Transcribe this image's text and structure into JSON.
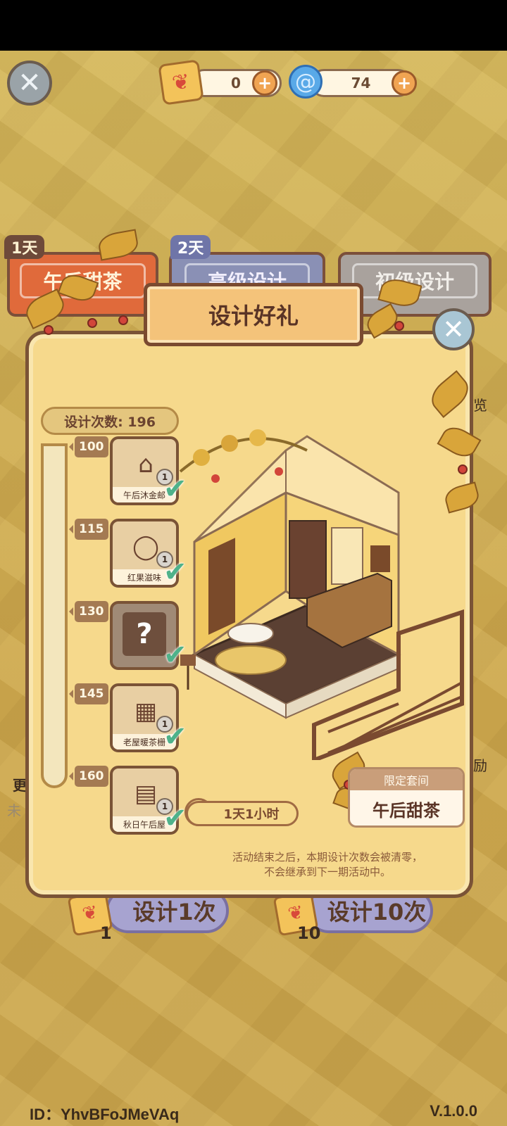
{
  "header": {
    "currency_tickets": "0",
    "currency_swirl": "74",
    "close_icon": "close-icon",
    "plus_icon": "plus-icon"
  },
  "tabs": [
    {
      "day": "1天",
      "label": "午后甜茶"
    },
    {
      "day": "2天",
      "label": "高级设计"
    },
    {
      "day": "",
      "label": "初级设计"
    }
  ],
  "side": {
    "right_top": "览",
    "right_mid": "励",
    "left_a": "更",
    "left_b": "未"
  },
  "modal": {
    "title": "设计好礼",
    "counter": "设计次数: 196",
    "milestones": [
      "100",
      "115",
      "130",
      "145",
      "160"
    ],
    "rewards": [
      {
        "name": "午后沐金邮",
        "qty": "1",
        "icon": "mailbox-icon",
        "checked": true
      },
      {
        "name": "红果滋味",
        "qty": "1",
        "icon": "wreath-icon",
        "checked": true
      },
      {
        "name": "",
        "qty": "",
        "icon": "question-mark-icon",
        "checked": true
      },
      {
        "name": "老屋暖茶栅",
        "qty": "1",
        "icon": "fence-icon",
        "checked": true
      },
      {
        "name": "秋日午后屋",
        "qty": "1",
        "icon": "floor-icon",
        "checked": true
      }
    ],
    "timer": "1天1小时",
    "limited_header": "限定套间",
    "limited_name": "午后甜茶",
    "notice_line1": "活动结束之后，本期设计次数会被清零，",
    "notice_line2": "不会继承到下一期活动中。"
  },
  "bottom": {
    "draw1_label": "设计1次",
    "draw1_count": "1",
    "draw10_label": "设计10次",
    "draw10_count": "10"
  },
  "footer": {
    "id": "ID：YhvBFoJMeVAq",
    "version": "V.1.0.0"
  }
}
